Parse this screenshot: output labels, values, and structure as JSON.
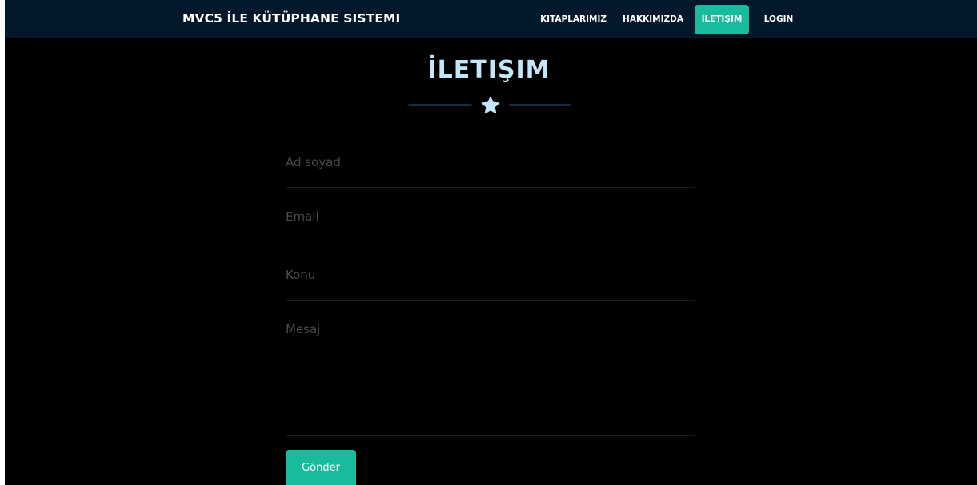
{
  "navbar": {
    "brand": "MVC5 İLE KÜTÜPHANE SISTEMI",
    "items": [
      {
        "label": "KITAPLARIMIZ",
        "active": false
      },
      {
        "label": "HAKKIMIZDA",
        "active": false
      },
      {
        "label": "İLETIŞIM",
        "active": true
      },
      {
        "label": "LOGIN",
        "active": false
      }
    ]
  },
  "page": {
    "title": "İLETIŞIM",
    "divider_icon": "star-icon"
  },
  "form": {
    "name_placeholder": "Ad soyad",
    "name_value": "",
    "email_placeholder": "Email",
    "email_value": "",
    "subject_placeholder": "Konu",
    "subject_value": "",
    "message_placeholder": "Mesaj",
    "message_value": "",
    "submit_label": "Gönder"
  },
  "colors": {
    "navbar_bg": "#04182b",
    "page_bg": "#000000",
    "accent": "#18bc9c",
    "title_color": "#c3e6fb"
  }
}
